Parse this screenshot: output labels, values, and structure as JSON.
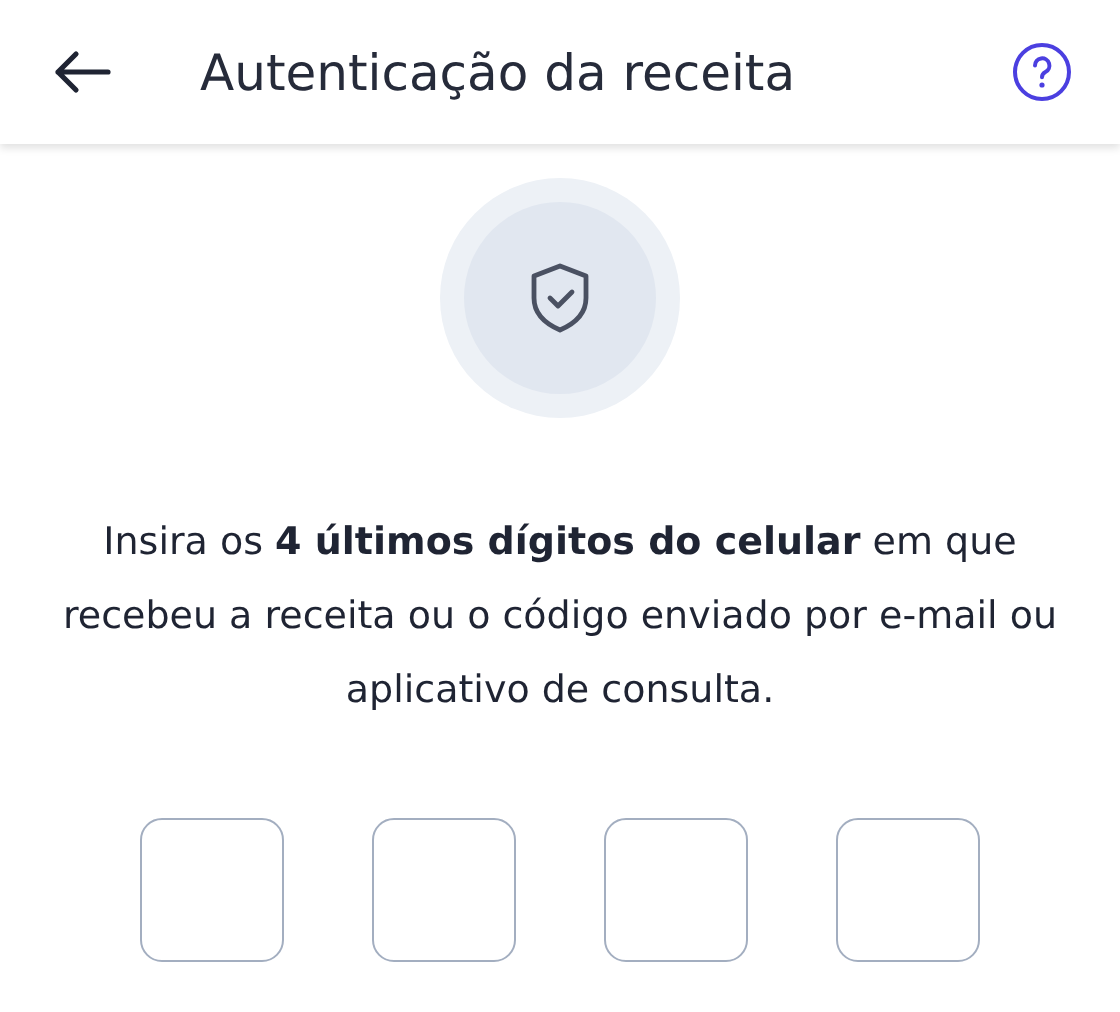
{
  "header": {
    "title": "Autenticação da receita"
  },
  "instructions": "Insira os **4 últimos dígitos do celular** em que recebeu a receita ou o código enviado por e-mail ou aplicativo de consulta.",
  "code_fields": [
    {
      "kind": "digit"
    },
    {
      "kind": "digit"
    },
    {
      "kind": "digit"
    },
    {
      "kind": "digit"
    }
  ]
}
